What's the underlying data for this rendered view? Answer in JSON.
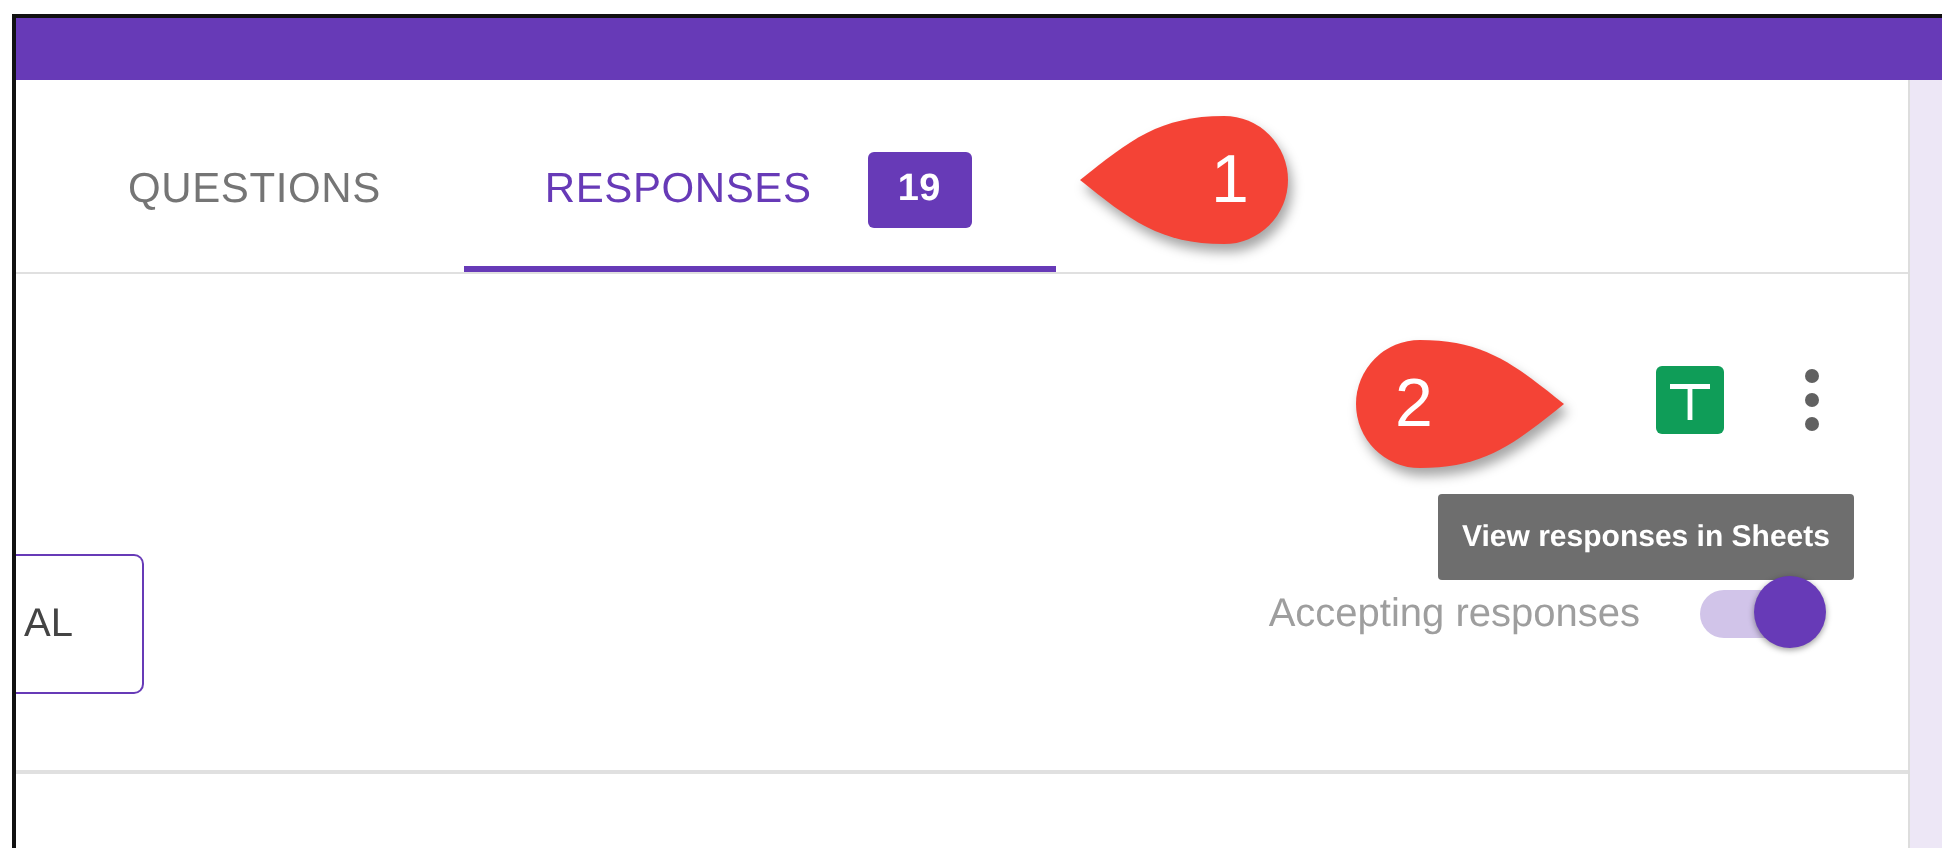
{
  "tabs": [
    {
      "label": "QUESTIONS",
      "selected": false
    },
    {
      "label": "RESPONSES",
      "selected": true,
      "badge": "19"
    }
  ],
  "callouts": [
    {
      "number": "1",
      "kind": "point-left"
    },
    {
      "number": "2",
      "kind": "point-right"
    }
  ],
  "tooltip": "View responses in Sheets",
  "left_button": "AL",
  "accepting": {
    "label": "Accepting responses",
    "on": true
  }
}
